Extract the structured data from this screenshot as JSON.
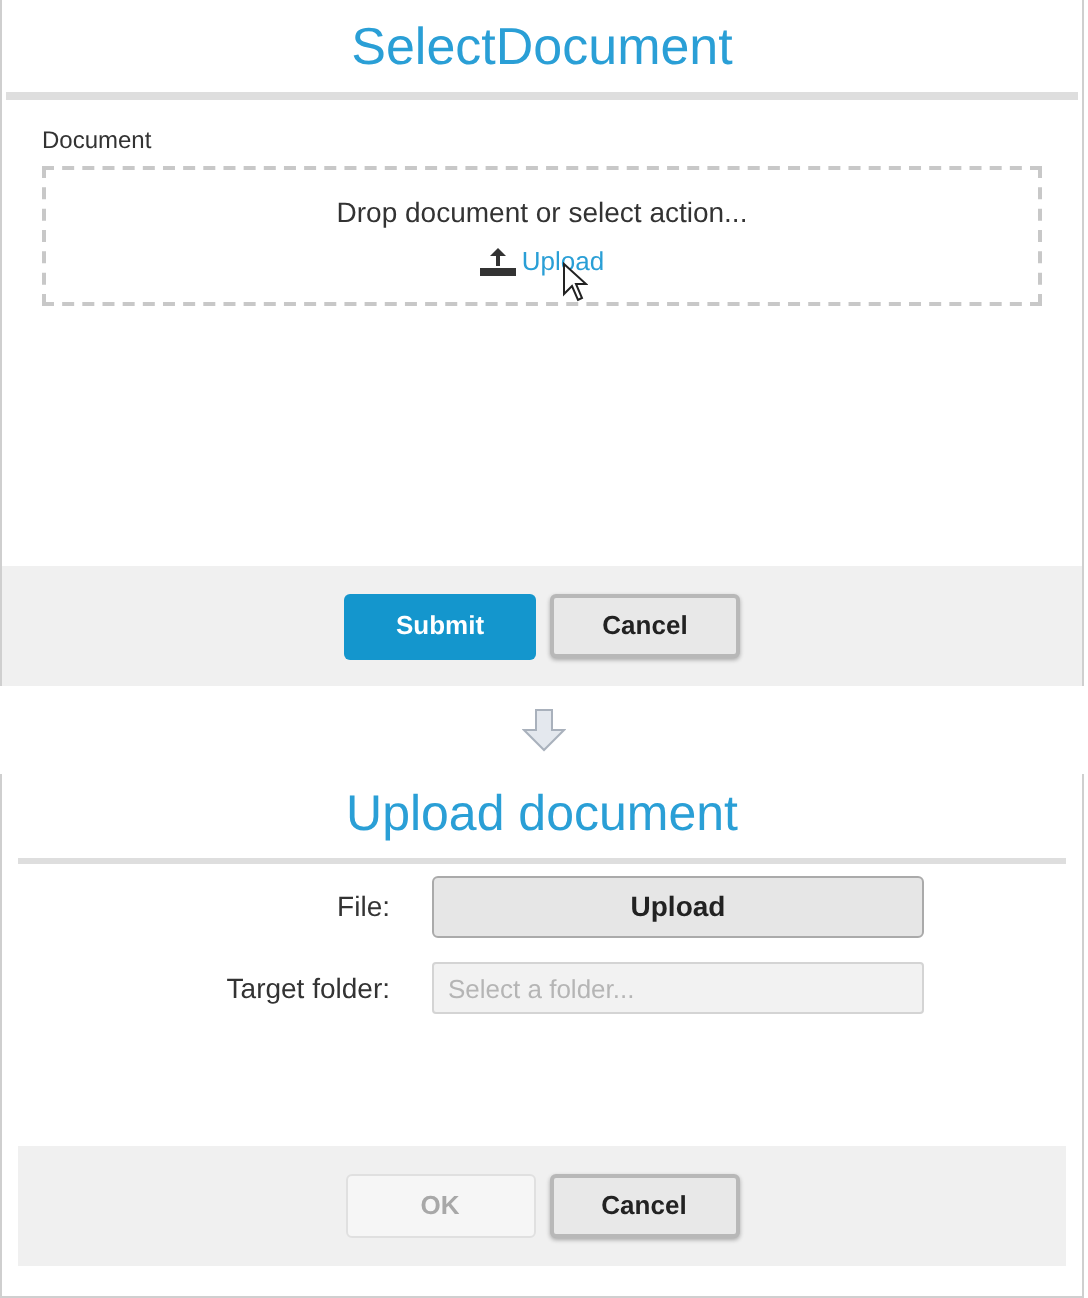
{
  "select_dialog": {
    "title": "SelectDocument",
    "field_label": "Document",
    "drop_zone": {
      "prompt": "Drop document or select action...",
      "action": "Upload"
    },
    "buttons": [
      {
        "label": "Submit",
        "kind": "primary",
        "disabled": false
      },
      {
        "label": "Cancel",
        "kind": "default",
        "disabled": false
      }
    ]
  },
  "upload_dialog": {
    "title": "Upload document",
    "fields": [
      {
        "label": "File:",
        "kind": "button",
        "value": "Upload"
      },
      {
        "label": "Target folder:",
        "kind": "select",
        "placeholder": "Select a folder..."
      }
    ],
    "buttons": [
      {
        "label": "OK",
        "kind": "default",
        "disabled": true
      },
      {
        "label": "Cancel",
        "kind": "default",
        "disabled": false
      }
    ]
  }
}
